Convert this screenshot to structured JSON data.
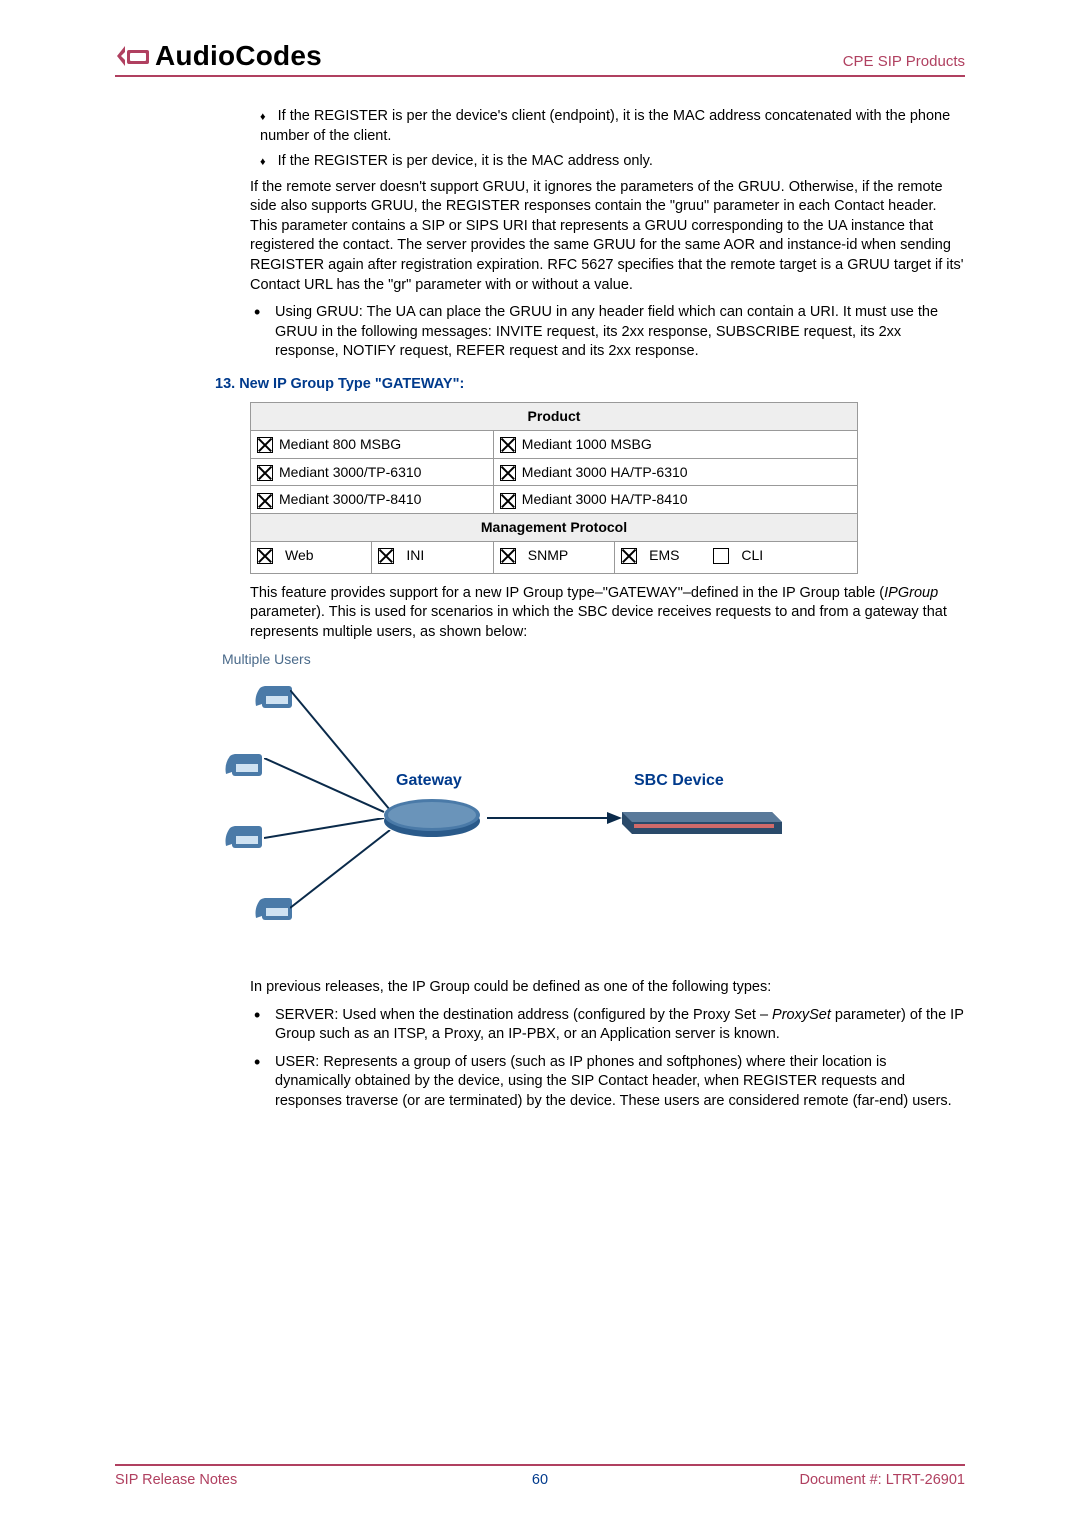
{
  "header": {
    "brand_word": "AudioCodes",
    "right": "CPE SIP Products"
  },
  "body": {
    "bullet1": "If the REGISTER is per the device's client (endpoint), it is the MAC address concatenated with the phone number of the client.",
    "bullet2": "If the REGISTER is per device, it is the MAC address only.",
    "para_gruu": "If the remote server doesn't support GRUU, it ignores the parameters of the GRUU. Otherwise, if the remote side also supports GRUU, the REGISTER responses contain the \"gruu\" parameter in each Contact header. This parameter contains a SIP or SIPS URI that represents a GRUU corresponding to the UA instance that registered the contact. The server provides the same GRUU for the same AOR and instance-id when sending REGISTER again after registration expiration. RFC 5627 specifies that the remote target is a GRUU target if its' Contact URL has the \"gr\" parameter with or without a value.",
    "using_gruu": "Using GRUU: The UA can place the GRUU in any header field which can contain a URI. It must use the GRUU in the following messages: INVITE request, its 2xx response, SUBSCRIBE request, its 2xx response, NOTIFY request, REFER request and its 2xx response.",
    "section_num": "13.",
    "section_title": "New IP Group Type \"GATEWAY\":",
    "table": {
      "product_header": "Product",
      "rows": [
        {
          "left": "Mediant 800 MSBG",
          "left_checked": true,
          "right": "Mediant 1000 MSBG",
          "right_checked": true
        },
        {
          "left": "Mediant 3000/TP-6310",
          "left_checked": true,
          "right": "Mediant 3000 HA/TP-6310",
          "right_checked": true
        },
        {
          "left": "Mediant 3000/TP-8410",
          "left_checked": true,
          "right": "Mediant 3000 HA/TP-8410",
          "right_checked": true
        }
      ],
      "mgmt_header": "Management Protocol",
      "protocols": [
        {
          "name": "Web",
          "checked": true
        },
        {
          "name": "INI",
          "checked": true
        },
        {
          "name": "SNMP",
          "checked": true
        },
        {
          "name": "EMS",
          "checked": true
        },
        {
          "name": "CLI",
          "checked": false
        }
      ]
    },
    "feature_para_pre": "This feature provides support for a new IP Group type–\"GATEWAY\"–defined in the IP Group table (",
    "feature_para_param": "IPGroup",
    "feature_para_post": " parameter). This is used for scenarios in which the SBC device receives requests to and from a gateway that represents multiple users, as shown below:",
    "diagram": {
      "multiple_users": "Multiple Users",
      "gateway_label": "Gateway",
      "sbc_label": "SBC Device"
    },
    "prev_para": "In previous releases, the IP Group could be defined as one of the following types:",
    "server_pre": "SERVER: Used when the destination address (configured by the Proxy Set – ",
    "server_param": "ProxySet",
    "server_post": " parameter) of the IP Group such as an ITSP, a Proxy, an IP-PBX, or an Application server is known.",
    "user_item": "USER: Represents a group of users (such as IP phones and softphones) where their location is dynamically obtained by the device, using the SIP Contact header, when REGISTER requests and responses traverse (or are terminated) by the device. These users are considered remote (far-end) users."
  },
  "footer": {
    "left": "SIP Release Notes",
    "page": "60",
    "right": "Document #: LTRT-26901"
  }
}
